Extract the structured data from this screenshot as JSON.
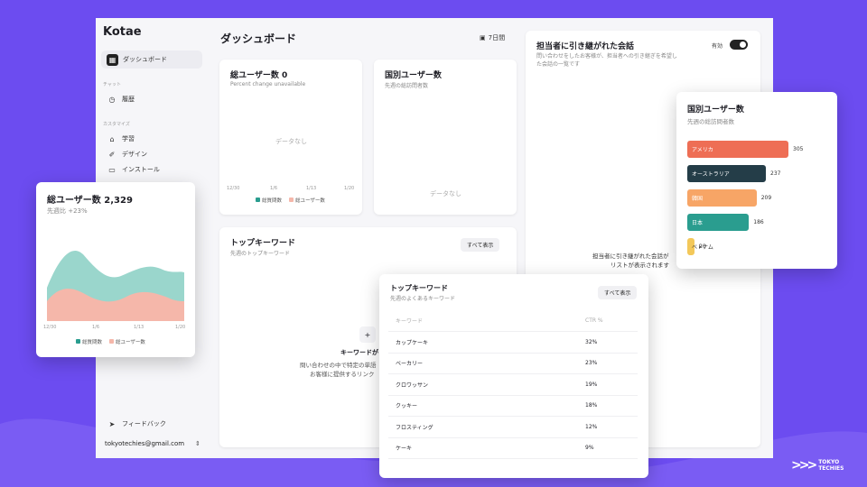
{
  "sidebar": {
    "brand": "Kotae",
    "dashboard": "ダッシュボード",
    "chat_heading": "チャット",
    "history": "履歴",
    "custom_heading": "カスタマイズ",
    "learning": "学習",
    "design": "デザイン",
    "install": "インストール",
    "feedback": "フィードバック",
    "email": "tokyotechies@gmail.com"
  },
  "main": {
    "title": "ダッシュボード",
    "period": "7日間"
  },
  "total_users_card": {
    "title": "総ユーザー数 0",
    "sub": "Percent change unavailable",
    "empty": "データなし",
    "ticks": [
      "12/30",
      "1/6",
      "1/13",
      "1/20"
    ],
    "legend": [
      "総質問数",
      "総ユーザー数"
    ]
  },
  "country_card": {
    "title": "国別ユーザー数",
    "sub": "先週の総訪問者数",
    "empty": "データなし"
  },
  "handoff_card": {
    "title": "担当者に引き継がれた会話",
    "sub1": "問い合わせをしたお客様が、担当者への引き継ぎを希望し",
    "sub2": "た会話の一覧です",
    "toggle_label": "有効",
    "empty1": "担当者に引き継がれた会話が",
    "empty2": "リストが表示されます"
  },
  "keywords_card": {
    "title": "トップキーワード",
    "sub": "先週のトップキーワード",
    "show_all": "すべて表示",
    "plus": "+",
    "empty_title": "キーワードが",
    "empty1": "問い合わせの中で特定の単語",
    "empty2": "お客様に提供するリンク"
  },
  "float_total_users": {
    "title": "総ユーザー数 2,329",
    "sub": "先週比 +23%",
    "ticks": [
      "12/30",
      "1/6",
      "1/13",
      "1/20"
    ],
    "legend": [
      "総質問数",
      "総ユーザー数"
    ],
    "colors": {
      "questions": "#9ad6cc",
      "users": "#f5b7aa"
    }
  },
  "float_country": {
    "title": "国別ユーザー数",
    "sub": "先週の総訪問者数",
    "rows": [
      {
        "name": "アメリカ",
        "value": "305",
        "color": "#ee6e55"
      },
      {
        "name": "オーストラリア",
        "value": "237",
        "color": "#243d48"
      },
      {
        "name": "韓国",
        "value": "209",
        "color": "#f7a566"
      },
      {
        "name": "日本",
        "value": "186",
        "color": "#2a9d8f"
      },
      {
        "name": "ベトナム",
        "value": "20",
        "color": "#f3c85a"
      }
    ]
  },
  "float_keywords": {
    "title": "トップキーワード",
    "sub": "先週のよくあるキーワード",
    "show_all": "すべて表示",
    "col_keyword": "キーワード",
    "col_ctr": "CTR %",
    "rows": [
      {
        "k": "カップケーキ",
        "v": "32%"
      },
      {
        "k": "ベーカリー",
        "v": "23%"
      },
      {
        "k": "クロワッサン",
        "v": "19%"
      },
      {
        "k": "クッキー",
        "v": "18%"
      },
      {
        "k": "フロスティング",
        "v": "12%"
      },
      {
        "k": "ケーキ",
        "v": "9%"
      }
    ]
  },
  "logo": {
    "line1": "TOKYO",
    "line2": "TECHIES"
  }
}
